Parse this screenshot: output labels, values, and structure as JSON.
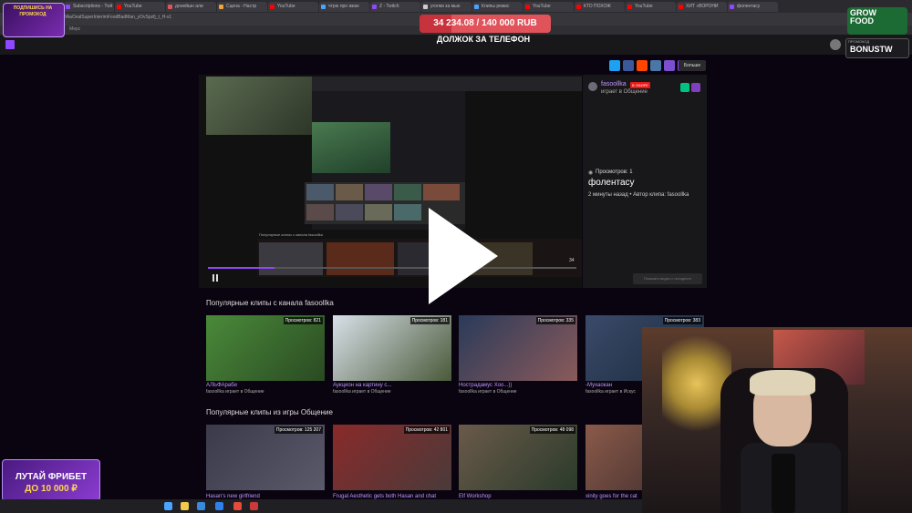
{
  "browser": {
    "tabs": [
      {
        "label": "Subscriptions - Twit",
        "color": "#9146ff"
      },
      {
        "label": "YouTube",
        "color": "#ff0000"
      },
      {
        "label": "донейшн али",
        "color": "#e0535a"
      },
      {
        "label": "Сцена - Настр",
        "color": "#f2a33a"
      },
      {
        "label": "YouTube",
        "color": "#ff0000"
      },
      {
        "label": "чтрю про жизн",
        "color": "#4aa3ff"
      },
      {
        "label": "Z - Twitch",
        "color": "#9146ff"
      },
      {
        "label": "уголки за мыо",
        "color": "#cccccc"
      },
      {
        "label": "Клипы режис",
        "color": "#4aa3ff"
      },
      {
        "label": "YouTube",
        "color": "#ff0000"
      },
      {
        "label": "КТО ПОХОЖ",
        "color": "#ff0000"
      },
      {
        "label": "YouTube",
        "color": "#ff0000"
      },
      {
        "label": "ХИТ «ВОРОНИ",
        "color": "#ff0000"
      },
      {
        "label": "фолентасу",
        "color": "#9146ff"
      }
    ],
    "url": "SwiftAaOvalSuperInterimFoodBadMan_yOvSpzfj_t_H-x1",
    "bookmark_label": "Мерс"
  },
  "donation": {
    "amount_text": "34 234.08 / 140 000 RUB",
    "current": 34234.08,
    "goal": 140000,
    "title": "ДОЛЖОК ЗА ТЕЛЕФОН"
  },
  "overlays": {
    "promo_top": "ПОДПИШИСЬ НА ПРОМОКОД",
    "grow_food": "GROW FOOD",
    "bonus_small": "ПРОМОКОД",
    "bonus_code": "BONUSTW",
    "promo_bottom_line1": "ЛУТАЙ ФРИБЕТ",
    "promo_bottom_line2": "ДО 10 000 ₽"
  },
  "share": {
    "more_label": "Больше",
    "buttons": [
      {
        "name": "twitter",
        "color": "#1da1f2"
      },
      {
        "name": "facebook",
        "color": "#3b5998"
      },
      {
        "name": "reddit",
        "color": "#ff4500"
      },
      {
        "name": "vk",
        "color": "#4a76a8"
      },
      {
        "name": "mail",
        "color": "#7b4fd0"
      },
      {
        "name": "embed",
        "color": "#9146ff"
      }
    ]
  },
  "player": {
    "popular_label": "Популярные клипы с канала fasoollka",
    "time": "34",
    "progress": 0.18
  },
  "clip_info": {
    "channel": "fasoollka",
    "live_badge": "В ЭФИРЕ",
    "playing": "играет в Общение",
    "views": "Просмотров: 1",
    "title": "фолентасу",
    "meta": "2 минуты назад • Автор клипа: fasoollka",
    "disabled_button": "Показать видео с исходного"
  },
  "section1": {
    "title": "Популярные клипы с канала fasoollka",
    "cards": [
      {
        "views": "Просмотров: 821",
        "title": "АЛЬФАраби",
        "sub": "fasoollka играет в Общение"
      },
      {
        "views": "Просмотров: 181",
        "title": "Аукцион на картину с...",
        "sub": "fasoollka играет в Общение"
      },
      {
        "views": "Просмотров: 335",
        "title": "Нострадамус Хоо...))",
        "sub": "fasoollka играет в Общение"
      },
      {
        "views": "Просмотров: 383",
        "title": "-Мухаокан",
        "sub": "fasoollka играет в Искус"
      }
    ]
  },
  "section2": {
    "title": "Популярные клипы из игры Общение",
    "cards": [
      {
        "views": "Просмотров: 125 207",
        "title": "Hasan's new girlfriend"
      },
      {
        "views": "Просмотров: 42 801",
        "title": "Frugal Aesthetic gets both Hasan and chat"
      },
      {
        "views": "Просмотров: 48 098",
        "title": "Elf Workshop"
      },
      {
        "views": "",
        "title": "xinity goes for the cat"
      }
    ]
  }
}
